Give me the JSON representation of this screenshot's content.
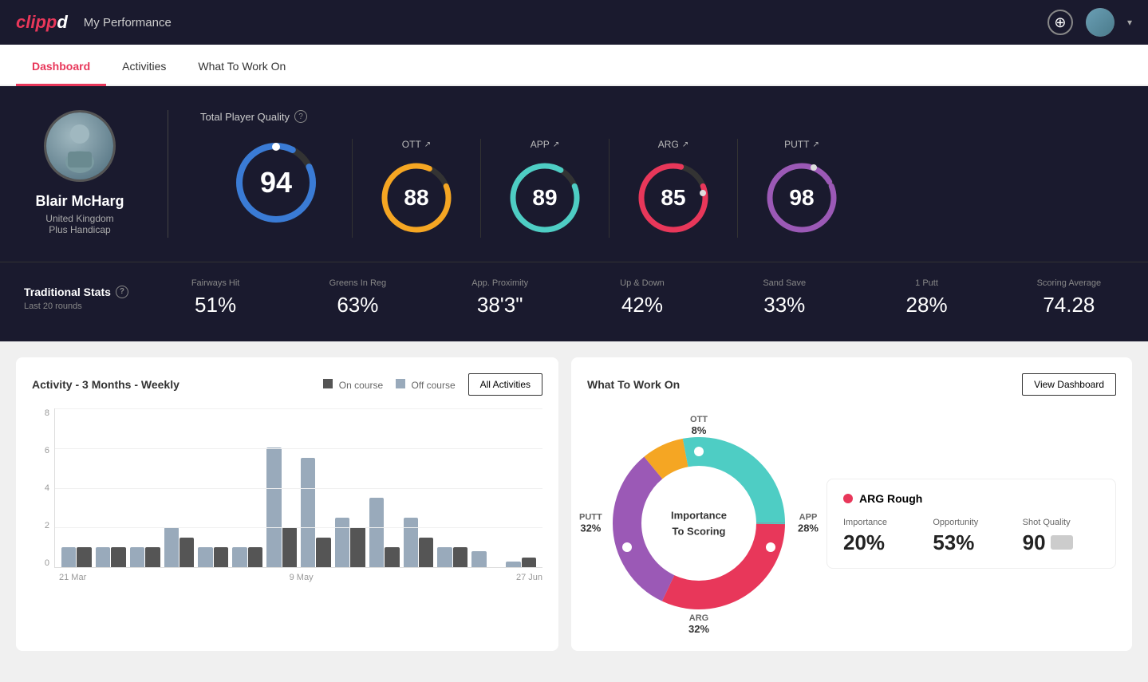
{
  "app": {
    "logo": "clippd",
    "nav_title": "My Performance"
  },
  "tabs": [
    {
      "id": "dashboard",
      "label": "Dashboard",
      "active": true
    },
    {
      "id": "activities",
      "label": "Activities",
      "active": false
    },
    {
      "id": "what-to-work-on",
      "label": "What To Work On",
      "active": false
    }
  ],
  "player": {
    "name": "Blair McHarg",
    "country": "United Kingdom",
    "handicap": "Plus Handicap"
  },
  "tpq": {
    "label": "Total Player Quality",
    "main_score": 94,
    "scores": [
      {
        "id": "ott",
        "label": "OTT",
        "value": 88,
        "color": "#f5a623",
        "bg": "#2a2a3e"
      },
      {
        "id": "app",
        "label": "APP",
        "value": 89,
        "color": "#4ecdc4",
        "bg": "#2a2a3e"
      },
      {
        "id": "arg",
        "label": "ARG",
        "value": 85,
        "color": "#e8375a",
        "bg": "#2a2a3e"
      },
      {
        "id": "putt",
        "label": "PUTT",
        "value": 98,
        "color": "#9b59b6",
        "bg": "#2a2a3e"
      }
    ]
  },
  "traditional_stats": {
    "label": "Traditional Stats",
    "period": "Last 20 rounds",
    "stats": [
      {
        "name": "Fairways Hit",
        "value": "51%"
      },
      {
        "name": "Greens In Reg",
        "value": "63%"
      },
      {
        "name": "App. Proximity",
        "value": "38'3\""
      },
      {
        "name": "Up & Down",
        "value": "42%"
      },
      {
        "name": "Sand Save",
        "value": "33%"
      },
      {
        "name": "1 Putt",
        "value": "28%"
      },
      {
        "name": "Scoring Average",
        "value": "74.28"
      }
    ]
  },
  "activity_chart": {
    "title": "Activity - 3 Months - Weekly",
    "legend": [
      {
        "label": "On course",
        "color": "#555"
      },
      {
        "label": "Off course",
        "color": "#9ab"
      }
    ],
    "all_activities_btn": "All Activities",
    "x_labels": [
      "21 Mar",
      "9 May",
      "27 Jun"
    ],
    "y_labels": [
      "8",
      "6",
      "4",
      "2",
      "0"
    ],
    "bars": [
      {
        "on": 1,
        "off": 1
      },
      {
        "on": 1,
        "off": 1
      },
      {
        "on": 1,
        "off": 1
      },
      {
        "on": 1.5,
        "off": 2
      },
      {
        "on": 1,
        "off": 1
      },
      {
        "on": 1,
        "off": 1
      },
      {
        "on": 2,
        "off": 6
      },
      {
        "on": 1.5,
        "off": 5.5
      },
      {
        "on": 2,
        "off": 2.5
      },
      {
        "on": 1,
        "off": 3.5
      },
      {
        "on": 1.5,
        "off": 2.5
      },
      {
        "on": 1,
        "off": 1
      },
      {
        "on": 0,
        "off": 0.8
      },
      {
        "on": 0.5,
        "off": 0.3
      }
    ]
  },
  "what_to_work_on": {
    "title": "What To Work On",
    "view_dashboard_btn": "View Dashboard",
    "donut_center": "Importance\nTo Scoring",
    "segments": [
      {
        "label": "OTT",
        "pct": "8%",
        "color": "#f5a623"
      },
      {
        "label": "APP",
        "pct": "28%",
        "color": "#4ecdc4"
      },
      {
        "label": "ARG",
        "pct": "32%",
        "color": "#e8375a"
      },
      {
        "label": "PUTT",
        "pct": "32%",
        "color": "#9b59b6"
      }
    ],
    "detail": {
      "title": "ARG Rough",
      "dot_color": "#e8375a",
      "metrics": [
        {
          "label": "Importance",
          "value": "20%"
        },
        {
          "label": "Opportunity",
          "value": "53%"
        },
        {
          "label": "Shot Quality",
          "value": "90"
        }
      ]
    }
  }
}
